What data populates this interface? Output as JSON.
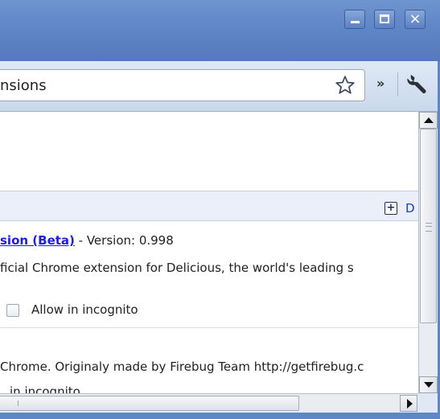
{
  "window": {
    "controls": {
      "minimize": "minimize",
      "maximize": "maximize",
      "close": "×"
    }
  },
  "toolbar": {
    "url_text": "nsions",
    "overflow_chevron": "»",
    "icons": {
      "bookmark": "star-icon",
      "menu": "wrench-icon"
    }
  },
  "content": {
    "section_header": {
      "developer_label": "D"
    },
    "extensions": [
      {
        "title_link": "sion (Beta)",
        "version_text": " - Version: 0.998",
        "description": "ficial Chrome extension for Delicious, the world's leading s",
        "incognito_label": "Allow in incognito"
      },
      {
        "description": "Chrome. Originaly made by Firebug Team http://getfirebug.c",
        "incognito_label": "in incognito"
      }
    ]
  },
  "colors": {
    "titlebar": "#5f86c6",
    "link": "#1a1aff",
    "header_band": "#ebeff9"
  }
}
